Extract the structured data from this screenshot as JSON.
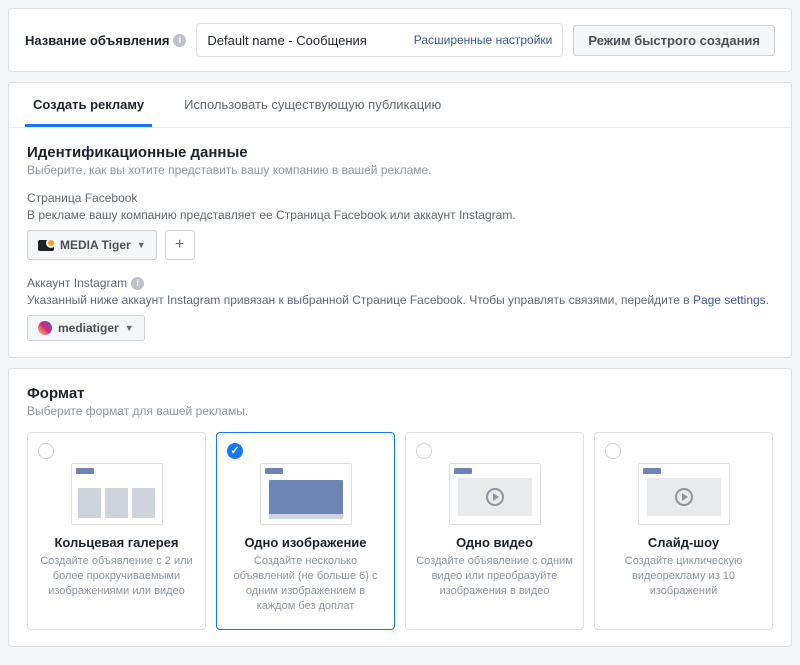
{
  "header": {
    "label": "Название объявления",
    "input_value": "Default name - Сообщения",
    "advanced_link": "Расширенные настройки",
    "quick_mode_btn": "Режим быстрого создания"
  },
  "tabs": {
    "create": "Создать рекламу",
    "existing": "Использовать существующую публикацию"
  },
  "identity": {
    "title": "Идентификационные данные",
    "subtitle": "Выберите, как вы хотите представить вашу компанию в вашей рекламе.",
    "fb_label": "Страница Facebook",
    "fb_help": "В рекламе вашу компанию представляет ее Страница Facebook или аккаунт Instagram.",
    "fb_selected": "MEDIA Tiger",
    "ig_label": "Аккаунт Instagram",
    "ig_help_pre": "Указанный ниже аккаунт Instagram привязан к выбранной Странице Facebook. Чтобы управлять связями, перейдите в ",
    "ig_help_link": "Page settings",
    "ig_selected": "mediatiger"
  },
  "format": {
    "title": "Формат",
    "subtitle": "Выберите формат для вашей рекламы.",
    "cards": [
      {
        "title": "Кольцевая галерея",
        "desc": "Создайте объявление с 2 или более прокручиваемыми изображениями или видео"
      },
      {
        "title": "Одно изображение",
        "desc": "Создайте несколько объявлений (не больше 6) с одним изображением в каждом без доплат"
      },
      {
        "title": "Одно видео",
        "desc": "Создайте объявление с одним видео или преобразуйте изображения в видео"
      },
      {
        "title": "Слайд-шоу",
        "desc": "Создайте циклическую видеорекламу из 10 изображений"
      }
    ]
  }
}
